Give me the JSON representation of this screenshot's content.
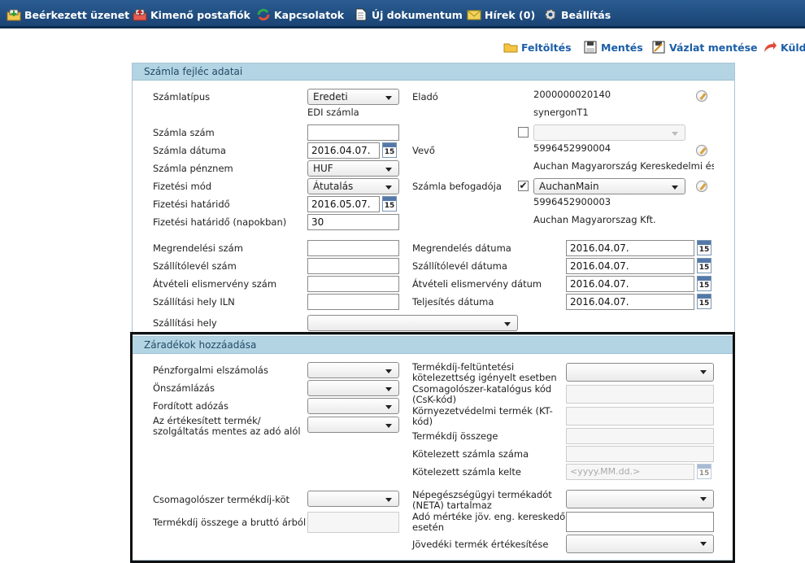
{
  "nav": {
    "items": [
      {
        "label": "Beérkezett üzenet",
        "icon": "inbox-icon"
      },
      {
        "label": "Kimenő postafiók",
        "icon": "outbox-icon"
      },
      {
        "label": "Kapcsolatok",
        "icon": "contacts-icon"
      },
      {
        "label": "Új dokumentum",
        "icon": "new-document-icon"
      },
      {
        "label": "Hírek (0)",
        "icon": "envelope-icon"
      },
      {
        "label": "Beállítás",
        "icon": "gear-icon"
      }
    ]
  },
  "toolbar": {
    "upload": "Feltöltés",
    "save": "Mentés",
    "save_draft": "Vázlat mentése",
    "send": "Küld"
  },
  "header_section": {
    "title": "Számla fejléc adatai",
    "invoice_type_label": "Számlatípus",
    "invoice_type_value": "Eredeti",
    "invoice_type_sub": "EDI számla",
    "seller_label": "Eladó",
    "seller_id": "2000000020140",
    "seller_name": "synergonT1",
    "invoice_number_label": "Számla szám",
    "invoice_number_value": "",
    "invoice_date_label": "Számla dátuma",
    "invoice_date_value": "2016.04.07.",
    "buyer_label": "Vevő",
    "buyer_id": "5996452990004",
    "buyer_name": "Auchan Magyarország Kereskedelmi és S",
    "currency_label": "Számla pénznem",
    "currency_value": "HUF",
    "payment_method_label": "Fizetési mód",
    "payment_method_value": "Átutalás",
    "receiver_label": "Számla befogadója",
    "receiver_value": "AuchanMain",
    "receiver_id": "5996452900003",
    "receiver_name": "Auchan Magyarorszag Kft.",
    "due_date_label": "Fizetési határidő",
    "due_date_value": "2016.05.07.",
    "due_days_label": "Fizetési határidő (napokban)",
    "due_days_value": "30",
    "order_number_label": "Megrendelési szám",
    "order_date_label": "Megrendelés dátuma",
    "order_date_value": "2016.04.07.",
    "delivery_note_label": "Szállítólevél szám",
    "delivery_note_date_label": "Szállítólevél dátuma",
    "delivery_note_date_value": "2016.04.07.",
    "acceptance_number_label": "Átvételi elismervény szám",
    "acceptance_date_label": "Átvételi elismervény dátum",
    "acceptance_date_value": "2016.04.07.",
    "delivery_iln_label": "Szállítási hely ILN",
    "fulfillment_date_label": "Teljesítés dátuma",
    "fulfillment_date_value": "2016.04.07.",
    "delivery_place_label": "Szállítási hely",
    "calendar_text": "15"
  },
  "clauses_section": {
    "title": "Záradékok hozzáadása",
    "cash_accounting_label": "Pénzforgalmi elszámolás",
    "self_billing_label": "Önszámlázás",
    "reverse_charge_label": "Fordított adózás",
    "exempt_label_1": "Az értékesített termék/",
    "exempt_label_2": "szolgáltatás mentes az adó alól",
    "product_fee_label_1": "Termékdíj-feltüntetési",
    "product_fee_label_2": "kötelezettség igényelt esetben",
    "packaging_catalog_label_1": "Csomagolószer-katalógus kód",
    "packaging_catalog_label_2": "(CsK-kód)",
    "environmental_label_1": "Környezetvédelmi termék (KT-",
    "environmental_label_2": "kód)",
    "product_fee_amount_label": "Termékdíj összege",
    "obligated_invoice_number_label": "Kötelezett számla száma",
    "obligated_invoice_date_label": "Kötelezett számla kelte",
    "obligated_invoice_date_placeholder": "<yyyy.MM.dd.>",
    "packaging_fee_label": "Csomagolószer termékdíj-köt",
    "fee_from_gross_label": "Termékdíj összege a bruttó árból",
    "neta_label_1": "Népegészségügyi termékadót",
    "neta_label_2": "(NETA) tartalmaz",
    "tax_rate_label_1": "Adó mértéke jöv. eng. kereskedő",
    "tax_rate_label_2": "esetén",
    "excise_label": "Jövedéki termék értékesítése"
  },
  "colors": {
    "nav_bg": "#1f4f82",
    "panel_head_bg": "#b3d4e3",
    "toolbar_text": "#1c5ea8"
  }
}
